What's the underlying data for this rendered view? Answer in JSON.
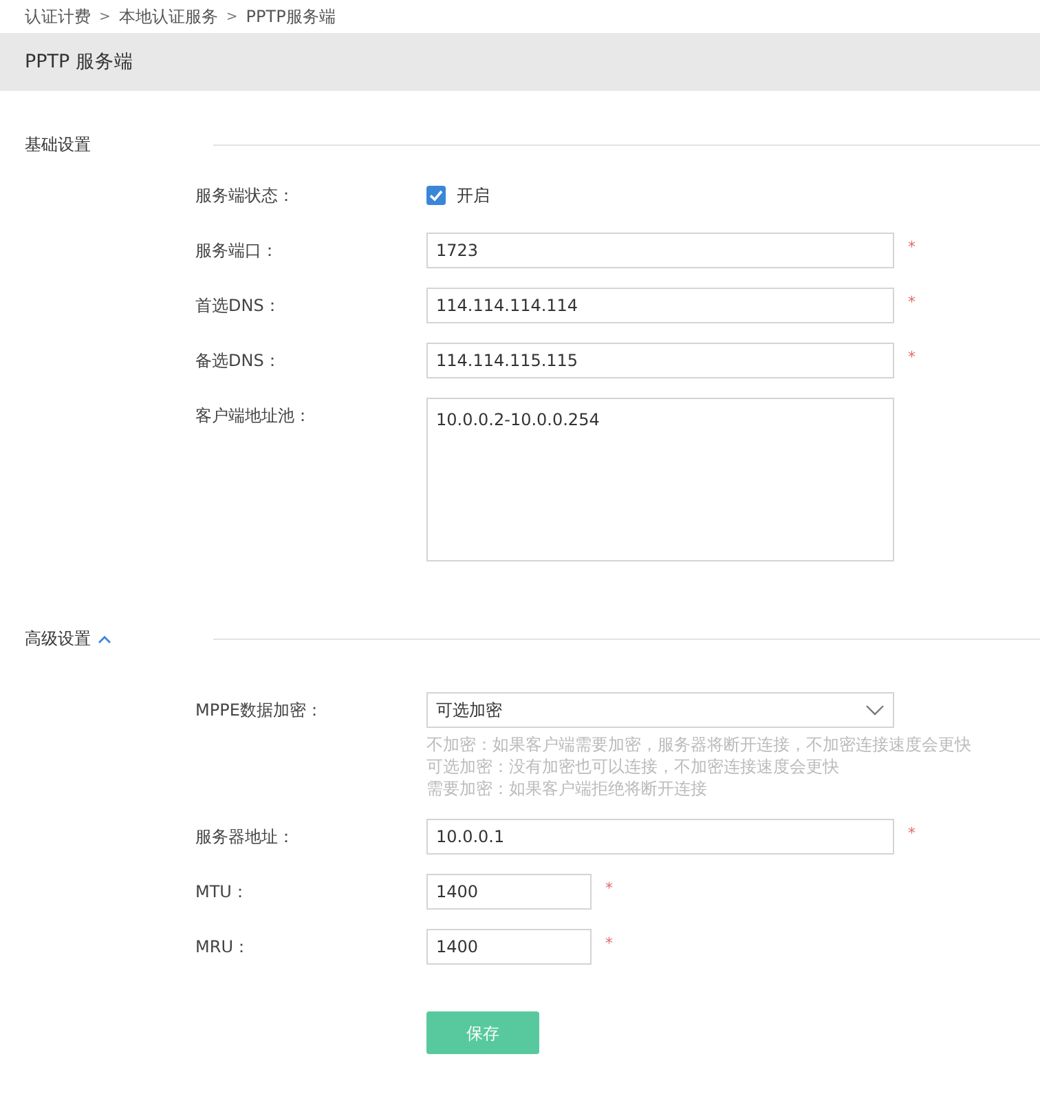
{
  "breadcrumb": [
    "认证计费",
    "本地认证服务",
    "PPTP服务端"
  ],
  "breadcrumb_separator": ">",
  "page_title": "PPTP 服务端",
  "sections": [
    {
      "title": "基础设置",
      "fields": [
        {
          "kind": "checkbox",
          "label": "服务端状态：",
          "checked": true,
          "option": "开启"
        },
        {
          "kind": "input",
          "label": "服务端口：",
          "value": "1723",
          "required_mark": "*"
        },
        {
          "kind": "input",
          "label": "首选DNS：",
          "value": "114.114.114.114",
          "required_mark": "*"
        },
        {
          "kind": "input",
          "label": "备选DNS：",
          "value": "114.114.115.115",
          "required_mark": "*"
        },
        {
          "kind": "textarea",
          "label": "客户端地址池：",
          "value": "10.0.0.2-10.0.0.254"
        }
      ]
    },
    {
      "title": "高级设置",
      "expanded": true,
      "fields": [
        {
          "kind": "select",
          "label": "MPPE数据加密：",
          "value": "可选加密",
          "help": [
            "不加密：如果客户端需要加密，服务器将断开连接，不加密连接速度会更快",
            "可选加密：没有加密也可以连接，不加密连接速度会更快",
            "需要加密：如果客户端拒绝将断开连接"
          ]
        },
        {
          "kind": "input",
          "label": "服务器地址：",
          "value": "10.0.0.1",
          "required_mark": "*"
        },
        {
          "kind": "short-input",
          "label": "MTU：",
          "value": "1400",
          "required_mark": "*"
        },
        {
          "kind": "short-input",
          "label": "MRU：",
          "value": "1400",
          "required_mark": "*"
        }
      ]
    }
  ],
  "save_button": {
    "label": "保存"
  }
}
